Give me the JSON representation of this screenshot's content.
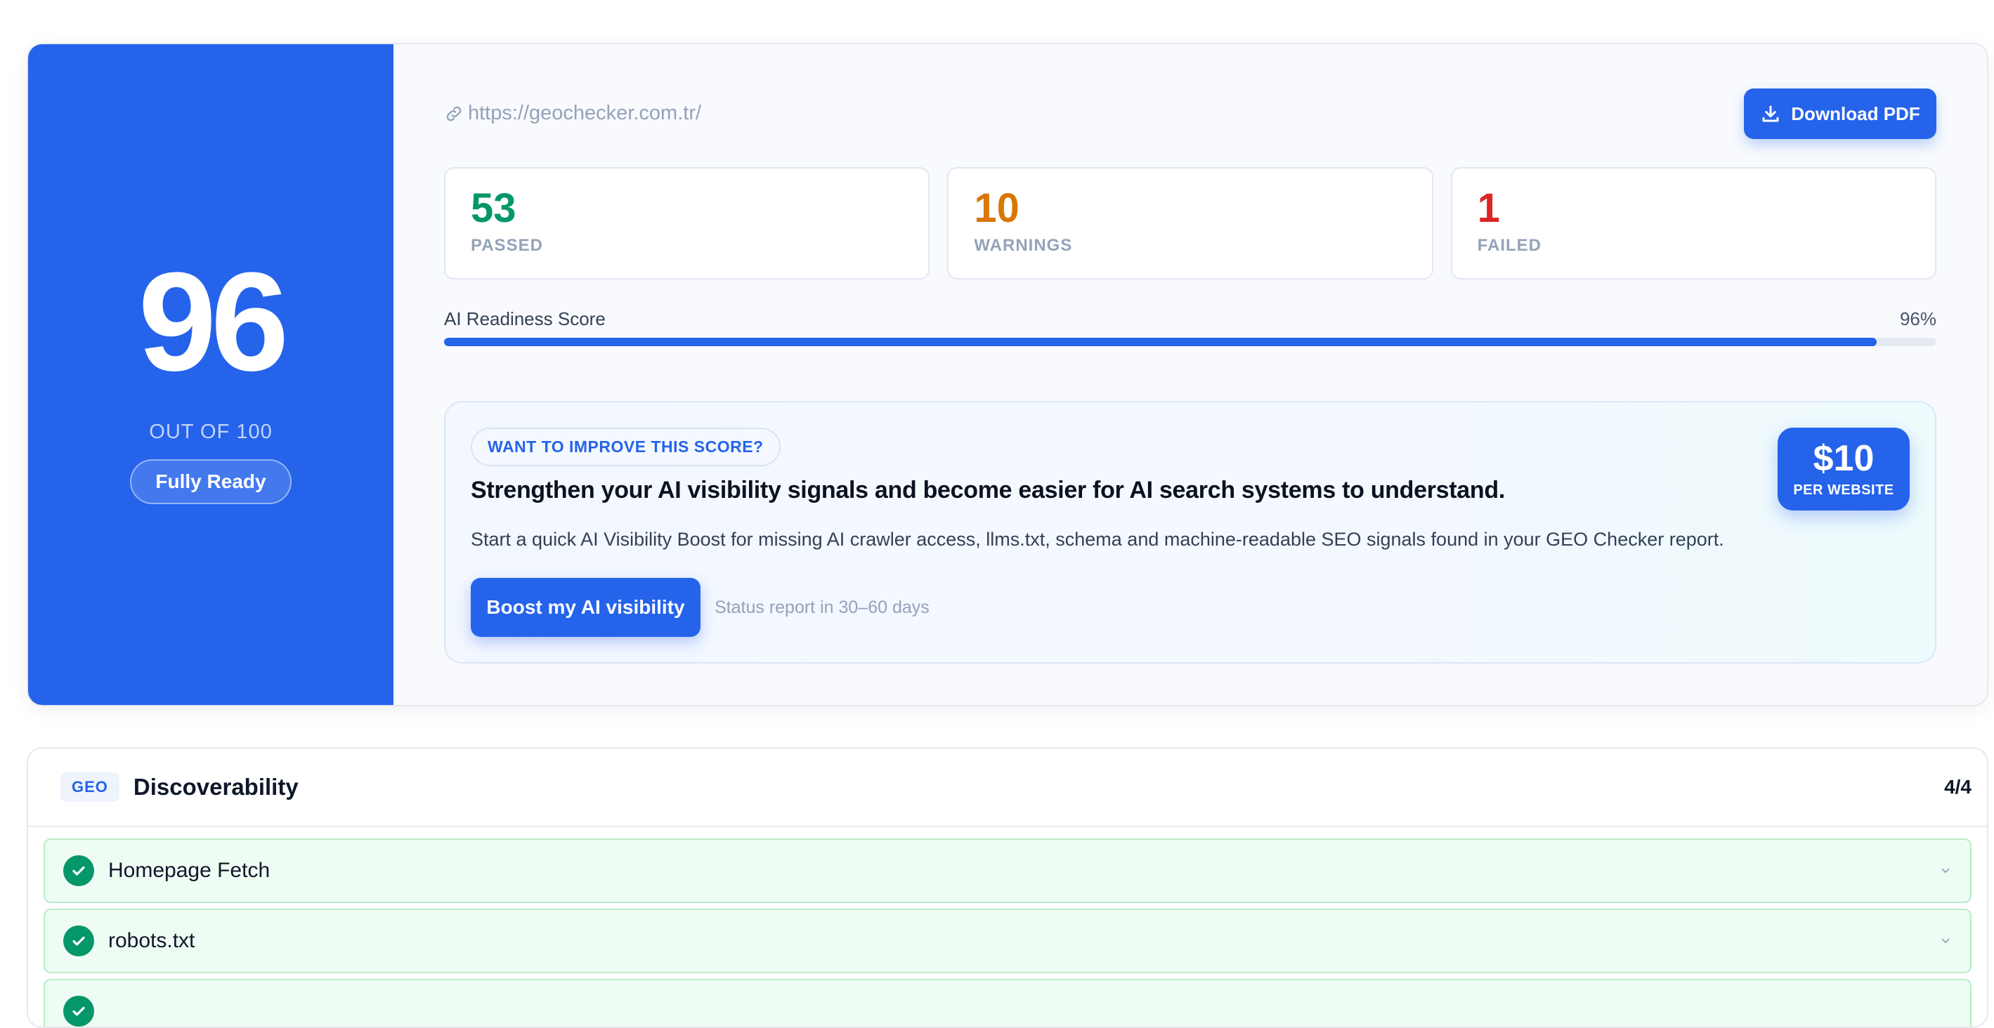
{
  "score": {
    "value": "96",
    "out_of": "OUT OF 100",
    "badge": "Fully Ready"
  },
  "header": {
    "url": "https://geochecker.com.tr/",
    "download_label": "Download PDF"
  },
  "stats": [
    {
      "value": "53",
      "label": "PASSED",
      "color": "#059669"
    },
    {
      "value": "10",
      "label": "WARNINGS",
      "color": "#d97706"
    },
    {
      "value": "1",
      "label": "FAILED",
      "color": "#dc2626"
    }
  ],
  "readiness": {
    "label": "AI Readiness Score",
    "percent_text": "96%",
    "progress_fraction": 0.96
  },
  "boost": {
    "tag": "WANT TO IMPROVE THIS SCORE?",
    "title": "Strengthen your AI visibility signals and become easier for AI search systems to understand.",
    "description": "Start a quick AI Visibility Boost for missing AI crawler access, llms.txt, schema and machine-readable SEO signals found in your GEO Checker report.",
    "button_label": "Boost my AI visibility",
    "status_text": "Status report in 30–60 days",
    "price": "$10",
    "price_unit": "PER WEBSITE"
  },
  "section": {
    "tag": "GEO",
    "title": "Discoverability",
    "count": "4/4",
    "items": [
      {
        "label": "Homepage Fetch",
        "status": "passed"
      },
      {
        "label": "robots.txt",
        "status": "passed"
      },
      {
        "label": "",
        "status": "passed"
      }
    ]
  },
  "colors": {
    "accent": "#2563eb",
    "passed": "#059669",
    "warning": "#d97706",
    "failed": "#dc2626"
  },
  "icons": {
    "url": "link-icon",
    "download": "download-icon",
    "check": "check-icon",
    "expand": "chevron-down-icon"
  }
}
